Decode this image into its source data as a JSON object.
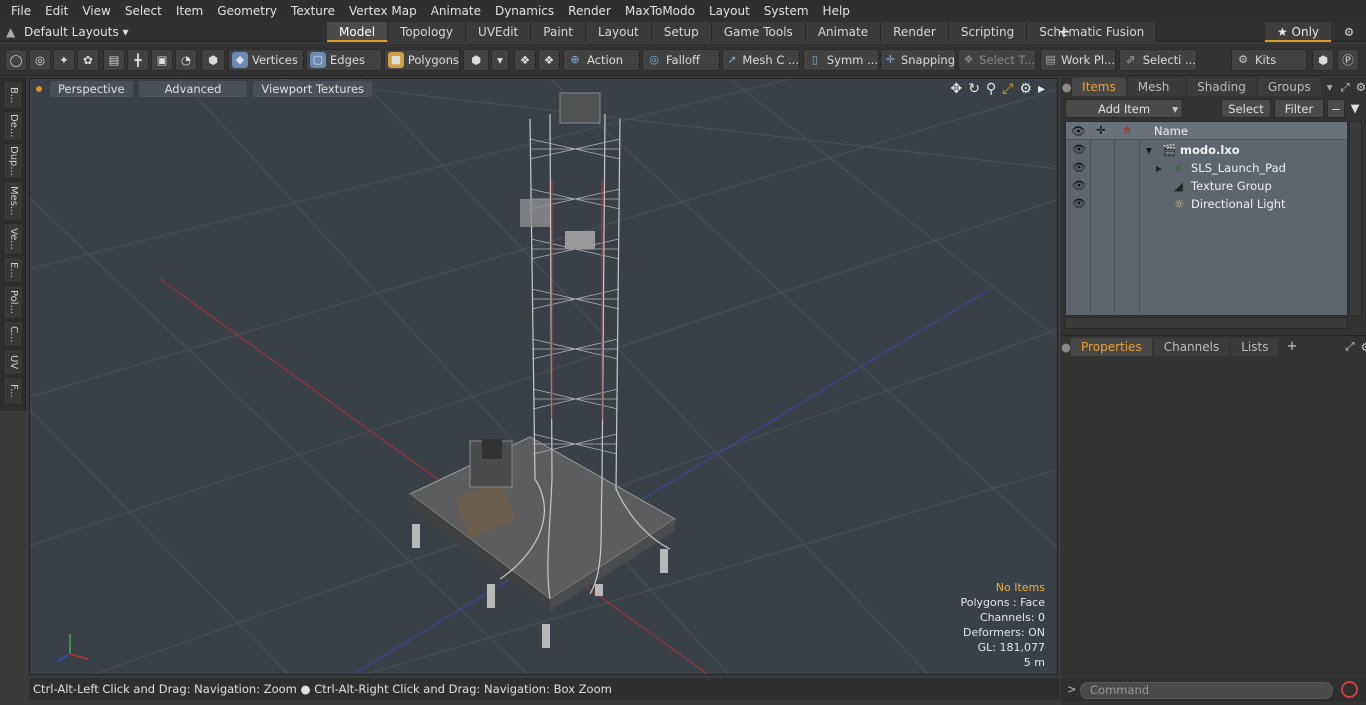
{
  "menu": [
    "File",
    "Edit",
    "View",
    "Select",
    "Item",
    "Geometry",
    "Texture",
    "Vertex Map",
    "Animate",
    "Dynamics",
    "Render",
    "MaxToModo",
    "Layout",
    "System",
    "Help"
  ],
  "layout_dropdown": "Default Layouts ▾",
  "tabs": [
    "Model",
    "Topology",
    "UVEdit",
    "Paint",
    "Layout",
    "Setup",
    "Game Tools",
    "Animate",
    "Render",
    "Scripting",
    "Schematic Fusion"
  ],
  "active_tab": "Model",
  "tab_plus": "+",
  "only_label": "★ Only",
  "toolbar": {
    "vertices": "Vertices",
    "edges": "Edges",
    "polygons": "Polygons",
    "action": "Action",
    "falloff": "Falloff",
    "mesh": "Mesh C ...",
    "symm": "Symm ...",
    "snapping": "Snapping",
    "select_t": "Select T...",
    "work_pl": "Work Pl...",
    "selecti": "Selecti ...",
    "kits": "Kits"
  },
  "left_strip": [
    "B...",
    "De...",
    "Dup...",
    "Mes...",
    "Ve...",
    "E...",
    "Pol...",
    "C...",
    "UV",
    "F..."
  ],
  "viewport": {
    "perspective": "Perspective",
    "advanced": "Advanced",
    "textures": "Viewport Textures"
  },
  "stats": {
    "no_items": "No Items",
    "polygons": "Polygons : Face",
    "channels": "Channels: 0",
    "deformers": "Deformers: ON",
    "gl": "GL: 181,077",
    "scale": "5 m"
  },
  "status": "Ctrl-Alt-Left Click and Drag: Navigation: Zoom ● Ctrl-Alt-Right Click and Drag: Navigation: Box Zoom",
  "items_panel": {
    "tabs": [
      "Items",
      "Mesh ...",
      "Shading",
      "Groups"
    ],
    "add_item": "Add Item",
    "select": "Select",
    "filter": "Filter",
    "col_name": "Name",
    "tree": [
      "modo.lxo",
      "SLS_Launch_Pad",
      "Texture Group",
      "Directional Light"
    ]
  },
  "props_panel": {
    "tabs": [
      "Properties",
      "Channels",
      "Lists"
    ],
    "plus": "+"
  },
  "command_placeholder": "Command",
  "colors": {
    "accent": "#e09a2a",
    "viewport_bg": "#394047",
    "tree_bg": "#5d666e"
  }
}
